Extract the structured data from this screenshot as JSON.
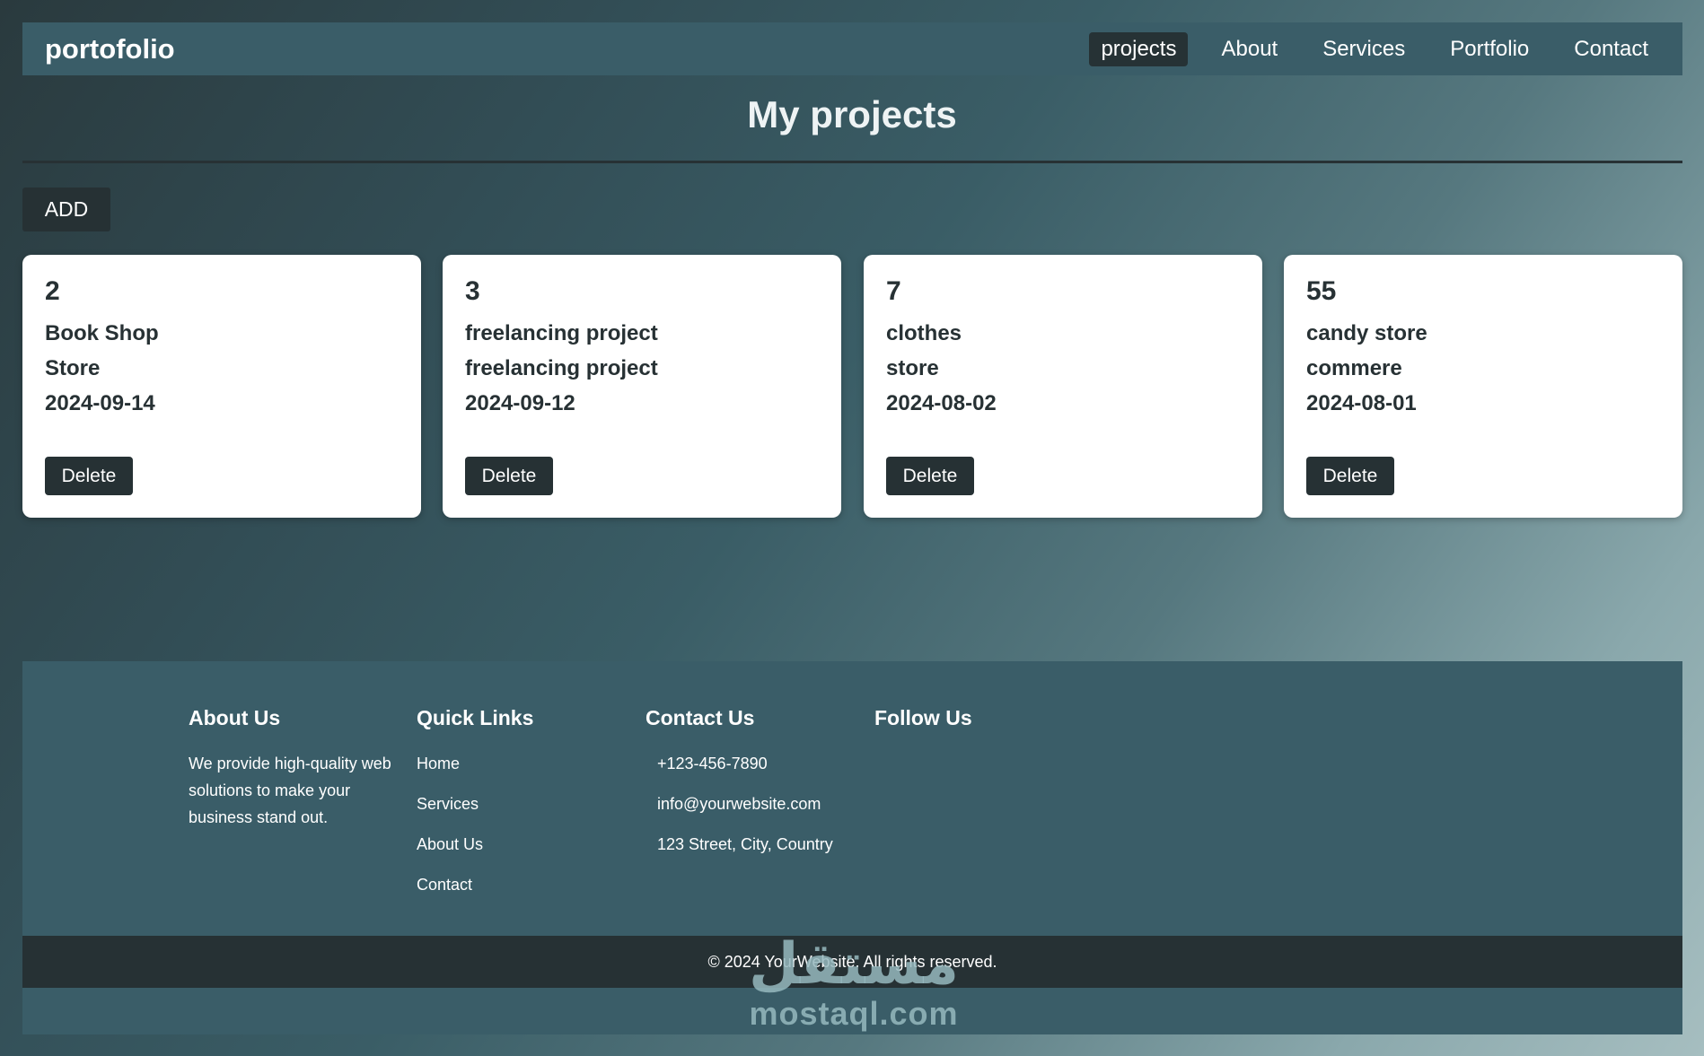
{
  "navbar": {
    "brand": "portofolio",
    "links": [
      {
        "label": "projects",
        "active": true
      },
      {
        "label": "About",
        "active": false
      },
      {
        "label": "Services",
        "active": false
      },
      {
        "label": "Portfolio",
        "active": false
      },
      {
        "label": "Contact",
        "active": false
      }
    ]
  },
  "page": {
    "title": "My projects",
    "add_label": "ADD"
  },
  "projects": [
    {
      "id": "2",
      "name": "Book Shop",
      "category": "Store",
      "date": "2024-09-14",
      "delete_label": "Delete"
    },
    {
      "id": "3",
      "name": "freelancing project",
      "category": "freelancing project",
      "date": "2024-09-12",
      "delete_label": "Delete"
    },
    {
      "id": "7",
      "name": "clothes",
      "category": "store",
      "date": "2024-08-02",
      "delete_label": "Delete"
    },
    {
      "id": "55",
      "name": "candy store",
      "category": "commere",
      "date": "2024-08-01",
      "delete_label": "Delete"
    }
  ],
  "footer": {
    "about": {
      "title": "About Us",
      "text": "We provide high-quality web solutions to make your business stand out."
    },
    "quick_links": {
      "title": "Quick Links",
      "links": [
        "Home",
        "Services",
        "About Us",
        "Contact"
      ]
    },
    "contact": {
      "title": "Contact Us",
      "phone": "+123-456-7890",
      "email": "info@yourwebsite.com",
      "address": "123 Street, City, Country"
    },
    "follow": {
      "title": "Follow Us"
    },
    "copyright": "© 2024 YourWebsite. All rights reserved."
  },
  "watermark": {
    "logo": "مستقل",
    "text": "mostaql.com"
  },
  "colors": {
    "navbar_bg": "#3a5d68",
    "dark_button": "#263134",
    "card_bg": "#ffffff"
  }
}
